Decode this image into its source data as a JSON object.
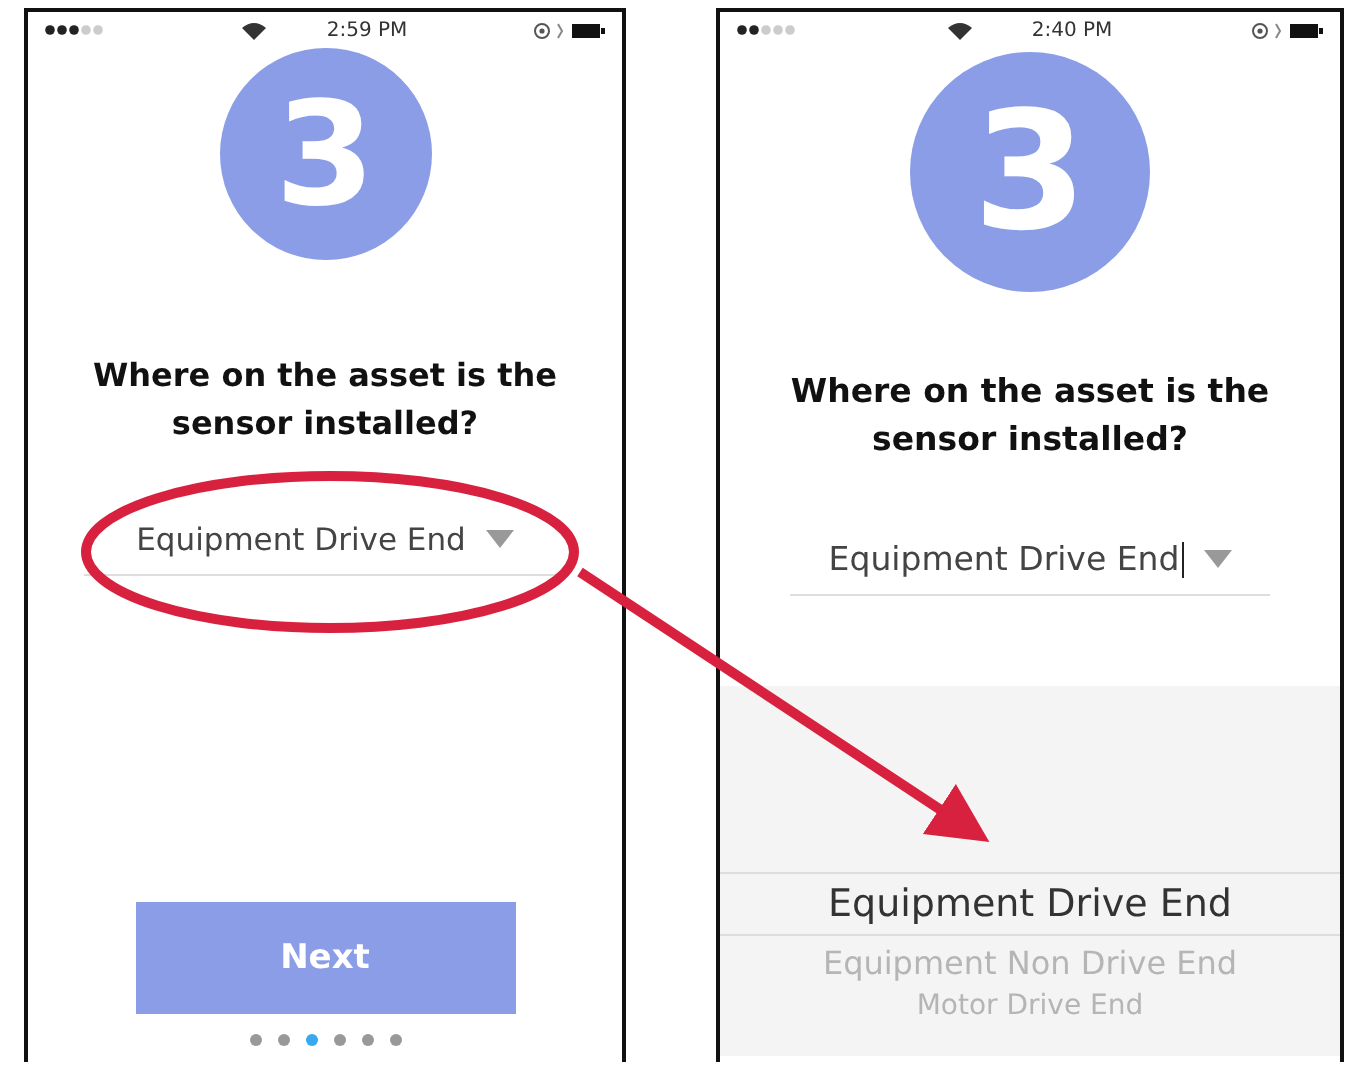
{
  "screens": [
    {
      "status_bar": {
        "time": "2:59 PM"
      },
      "step_number": "3",
      "question": "Where on the asset is the sensor installed?",
      "dropdown": {
        "value": "Equipment Drive End",
        "focused": false
      },
      "next_button": "Next",
      "page_dots": [
        {
          "selected": false
        },
        {
          "selected": false
        },
        {
          "selected": true
        },
        {
          "selected": false
        },
        {
          "selected": false
        },
        {
          "selected": false
        }
      ]
    },
    {
      "status_bar": {
        "time": "2:40 PM"
      },
      "step_number": "3",
      "question": "Where on the asset is the sensor installed?",
      "dropdown": {
        "value": "Equipment Drive End",
        "focused": true
      },
      "picker": [
        {
          "label": "Equipment Drive End",
          "selected": true
        },
        {
          "label": "Equipment Non Drive End",
          "selected": false
        },
        {
          "label": "Motor Drive End",
          "selected": false
        }
      ]
    }
  ]
}
